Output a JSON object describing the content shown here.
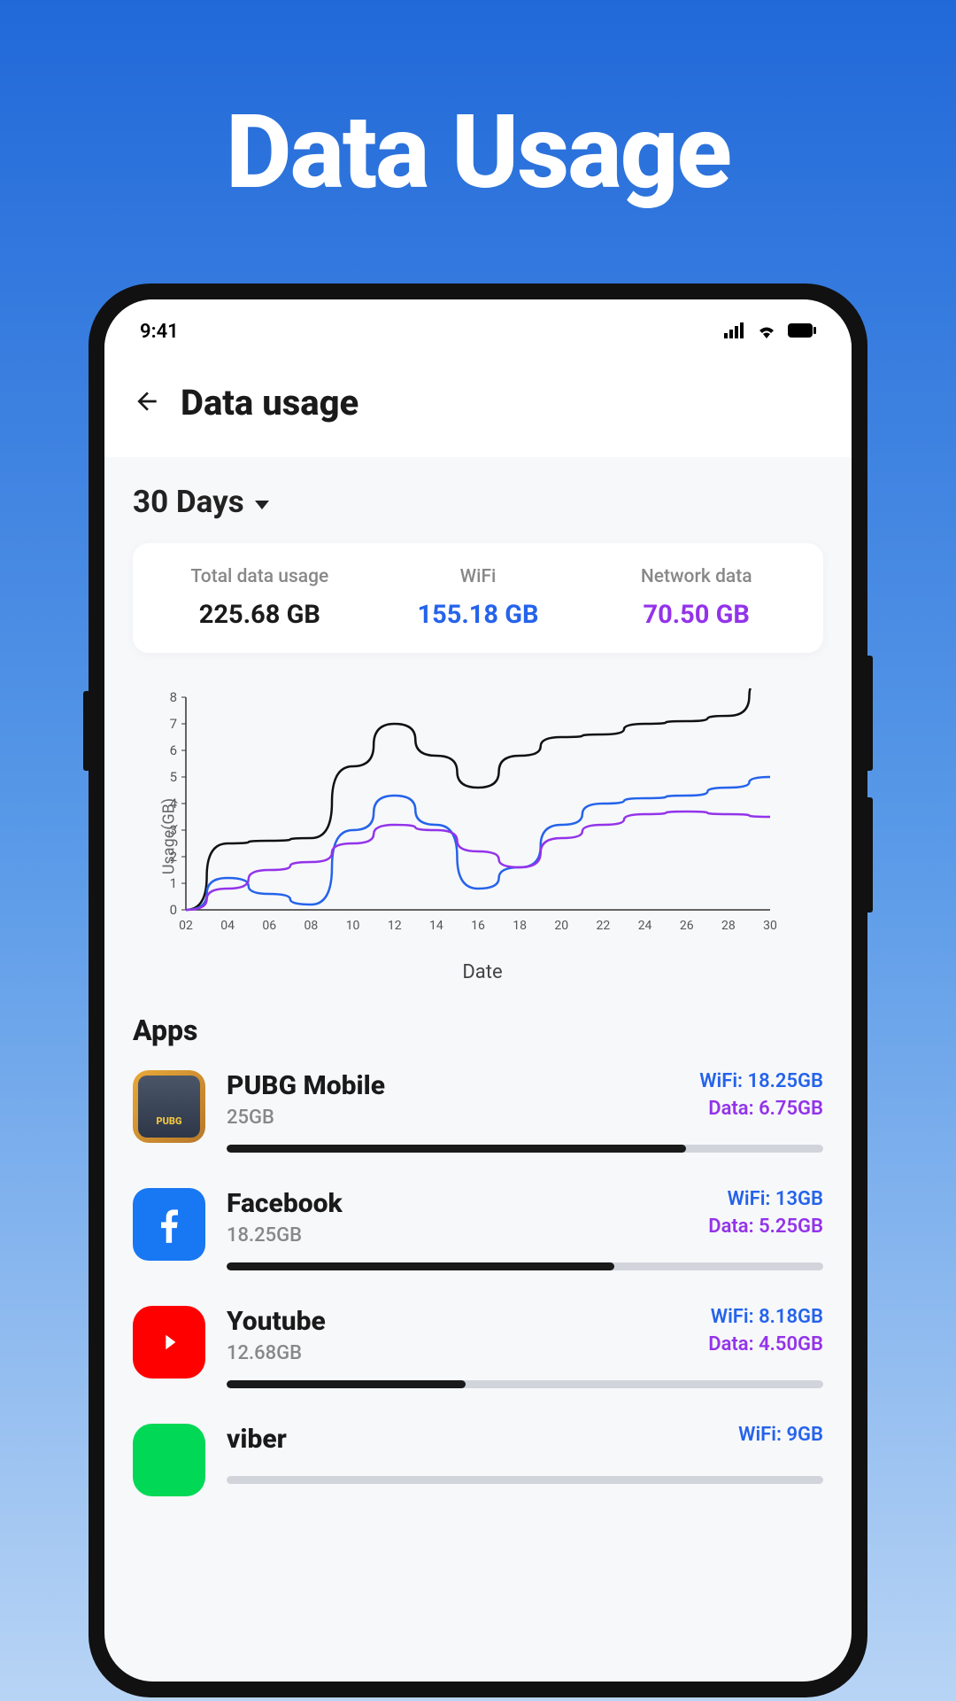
{
  "hero": {
    "title": "Data Usage"
  },
  "status_bar": {
    "time": "9:41"
  },
  "header": {
    "title": "Data usage"
  },
  "period": {
    "label": "30 Days"
  },
  "summary": {
    "total": {
      "label": "Total data usage",
      "value": "225.68 GB"
    },
    "wifi": {
      "label": "WiFi",
      "value": "155.18 GB"
    },
    "network": {
      "label": "Network data",
      "value": "70.50 GB"
    }
  },
  "chart_data": {
    "type": "line",
    "xlabel": "Date",
    "ylabel": "Usage(GB)",
    "ylim": [
      0,
      8
    ],
    "x": [
      "02",
      "04",
      "06",
      "08",
      "10",
      "12",
      "14",
      "16",
      "18",
      "20",
      "22",
      "24",
      "26",
      "28",
      "30"
    ],
    "y_ticks": [
      0,
      1,
      2,
      3,
      4,
      5,
      6,
      7,
      8
    ],
    "series": [
      {
        "name": "Total",
        "color": "#111",
        "values": [
          0.0,
          2.5,
          2.6,
          2.7,
          5.4,
          7.0,
          5.8,
          4.6,
          5.8,
          6.5,
          6.6,
          7.0,
          7.1,
          7.3,
          8.8
        ]
      },
      {
        "name": "WiFi",
        "color": "#2563eb",
        "values": [
          0.0,
          1.2,
          0.6,
          0.2,
          3.0,
          4.3,
          3.2,
          0.8,
          1.6,
          3.2,
          4.0,
          4.2,
          4.3,
          4.6,
          5.0
        ]
      },
      {
        "name": "Data",
        "color": "#9333ea",
        "values": [
          0.0,
          0.8,
          1.5,
          1.8,
          2.5,
          3.2,
          3.0,
          2.2,
          1.6,
          2.7,
          3.2,
          3.6,
          3.7,
          3.6,
          3.5
        ]
      }
    ]
  },
  "apps_section": {
    "title": "Apps"
  },
  "apps": [
    {
      "name": "PUBG Mobile",
      "total": "25GB",
      "wifi": "WiFi: 18.25GB",
      "data": "Data: 6.75GB",
      "progress": 77,
      "icon": "pubg"
    },
    {
      "name": "Facebook",
      "total": "18.25GB",
      "wifi": "WiFi: 13GB",
      "data": "Data: 5.25GB",
      "progress": 65,
      "icon": "facebook"
    },
    {
      "name": "Youtube",
      "total": "12.68GB",
      "wifi": "WiFi: 8.18GB",
      "data": "Data: 4.50GB",
      "progress": 40,
      "icon": "youtube"
    },
    {
      "name": "viber",
      "total": "",
      "wifi": "WiFi: 9GB",
      "data": "",
      "progress": 0,
      "icon": "viber"
    }
  ]
}
